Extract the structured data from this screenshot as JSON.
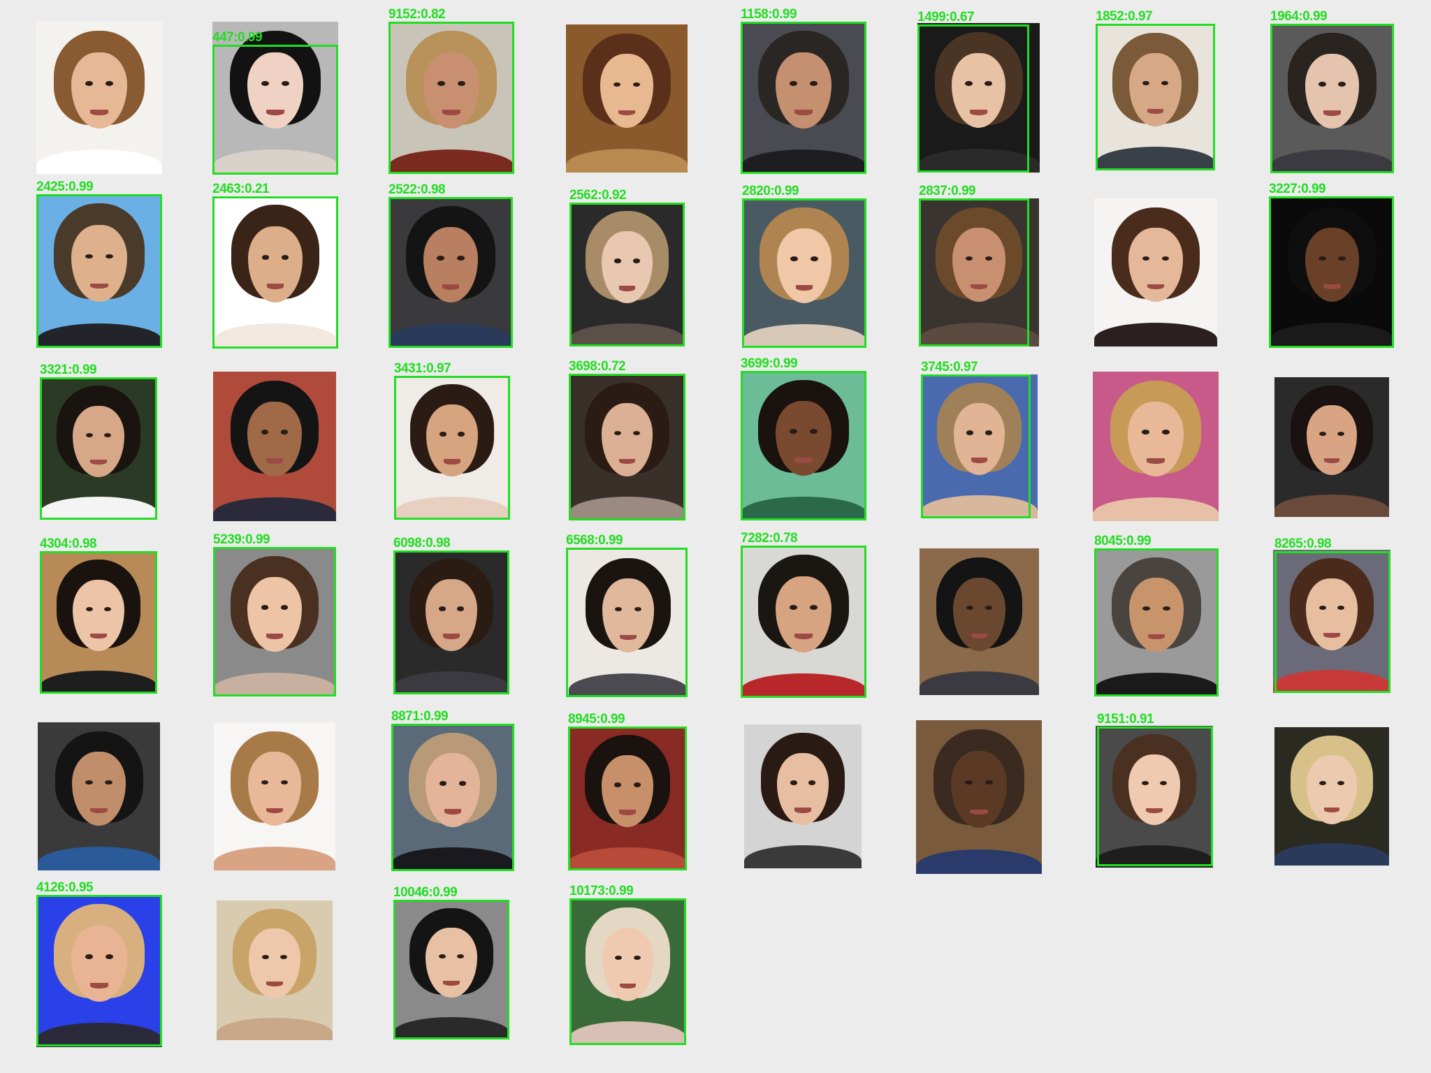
{
  "colors": {
    "background": "#ececec",
    "detection_box": "#22dd22",
    "label": "#22dd22"
  },
  "faces": [
    {
      "label": "",
      "bg": "#f4f2ee",
      "hair": "#8a5a32",
      "skin": "#e6b896",
      "clothes": "#ffffff"
    },
    {
      "label": "447:0.99",
      "bg": "#b8b8b8",
      "hair": "#121212",
      "skin": "#efd2c4",
      "clothes": "#d8d2ca"
    },
    {
      "label": "9152:0.82",
      "bg": "#c9c4b8",
      "hair": "#b8925a",
      "skin": "#c89070",
      "clothes": "#7a2a1e"
    },
    {
      "label": "",
      "bg": "#8a5a2c",
      "hair": "#5a301a",
      "skin": "#e8b890",
      "clothes": "#b88a50"
    },
    {
      "label": "1158:0.99",
      "bg": "#4a4a52",
      "hair": "#2a2624",
      "skin": "#c49070",
      "clothes": "#1e1e22"
    },
    {
      "label": "1499:0.67",
      "bg": "#1a1a1a",
      "hair": "#4a3424",
      "skin": "#e8c2a4",
      "clothes": "#2a2a2a"
    },
    {
      "label": "1852:0.97",
      "bg": "#e8e4dc",
      "hair": "#7a5a38",
      "skin": "#d6a886",
      "clothes": "#3a4048"
    },
    {
      "label": "1964:0.99",
      "bg": "#5a5a5a",
      "hair": "#2a2420",
      "skin": "#e4c4ae",
      "clothes": "#3a3a40"
    },
    {
      "label": "2425:0.99",
      "bg": "#6ab0e4",
      "hair": "#4a3a2a",
      "skin": "#deb08c",
      "clothes": "#22242a"
    },
    {
      "label": "2463:0.21",
      "bg": "#ffffff",
      "hair": "#3a2418",
      "skin": "#dcae8a",
      "clothes": "#f2e8e0"
    },
    {
      "label": "2522:0.98",
      "bg": "#3a3a3c",
      "hair": "#141414",
      "skin": "#b88060",
      "clothes": "#2a3a5a"
    },
    {
      "label": "2562:0.92",
      "bg": "#2a2a2a",
      "hair": "#a88c68",
      "skin": "#e8c8b0",
      "clothes": "#5a5048"
    },
    {
      "label": "2820:0.99",
      "bg": "#4a5a62",
      "hair": "#b08450",
      "skin": "#f0c8a8",
      "clothes": "#d8c8b8"
    },
    {
      "label": "2837:0.99",
      "bg": "#3a3430",
      "hair": "#6a4a2a",
      "skin": "#c89070",
      "clothes": "#5a4a40"
    },
    {
      "label": "",
      "bg": "#f6f4f2",
      "hair": "#4a2c1c",
      "skin": "#e6b89a",
      "clothes": "#2a2020"
    },
    {
      "label": "3227:0.99",
      "bg": "#0a0a0a",
      "hair": "#0e0e0e",
      "skin": "#6a4028",
      "clothes": "#1a1a1a"
    },
    {
      "label": "3321:0.99",
      "bg": "#2a3a24",
      "hair": "#1a1410",
      "skin": "#d6a888",
      "clothes": "#f4f4f4"
    },
    {
      "label": "",
      "bg": "#b04a3a",
      "hair": "#141414",
      "skin": "#a06a48",
      "clothes": "#2a2a3a"
    },
    {
      "label": "3431:0.97",
      "bg": "#efece8",
      "hair": "#2a1c14",
      "skin": "#d6a47e",
      "clothes": "#e8d0c0"
    },
    {
      "label": "3698:0.72",
      "bg": "#3a302a",
      "hair": "#2a1c14",
      "skin": "#dcb094",
      "clothes": "#9a8a80"
    },
    {
      "label": "3699:0.99",
      "bg": "#6cbc98",
      "hair": "#1a120e",
      "skin": "#7a4a30",
      "clothes": "#2a6a4a"
    },
    {
      "label": "3745:0.97",
      "bg": "#4a6ab0",
      "hair": "#a08058",
      "skin": "#e0b494",
      "clothes": "#d8b89c"
    },
    {
      "label": "",
      "bg": "#c85a8a",
      "hair": "#c89a58",
      "skin": "#e8b898",
      "clothes": "#e8c0a8"
    },
    {
      "label": "",
      "bg": "#2a2a2a",
      "hair": "#1a1210",
      "skin": "#d8a484",
      "clothes": "#6a4a3a"
    },
    {
      "label": "4304:0.98",
      "bg": "#b88a58",
      "hair": "#1a120e",
      "skin": "#ecc4a8",
      "clothes": "#1e1e1e"
    },
    {
      "label": "5239:0.99",
      "bg": "#8a8a8a",
      "hair": "#4a3020",
      "skin": "#eec4a6",
      "clothes": "#c8b0a0"
    },
    {
      "label": "6098:0.98",
      "bg": "#2a2a2a",
      "hair": "#2a1c12",
      "skin": "#d6a888",
      "clothes": "#3a3a40"
    },
    {
      "label": "6568:0.99",
      "bg": "#ece8e4",
      "hair": "#1a1410",
      "skin": "#e0b89c",
      "clothes": "#4a4a50"
    },
    {
      "label": "7282:0.78",
      "bg": "#d8d8d4",
      "hair": "#1a1612",
      "skin": "#d6a480",
      "clothes": "#b8282a"
    },
    {
      "label": "",
      "bg": "#8a6a4a",
      "hair": "#141414",
      "skin": "#6a4830",
      "clothes": "#3a3a40"
    },
    {
      "label": "8045:0.99",
      "bg": "#9a9a9a",
      "hair": "#4a4440",
      "skin": "#c8946c",
      "clothes": "#1a1a1a"
    },
    {
      "label": "8265:0.98",
      "bg": "#6a6a78",
      "hair": "#4a2a1a",
      "skin": "#e8bea0",
      "clothes": "#c83a3a"
    },
    {
      "label": "",
      "bg": "#3a3a3a",
      "hair": "#141414",
      "skin": "#c08e6a",
      "clothes": "#2a5a9a"
    },
    {
      "label": "",
      "bg": "#f8f6f4",
      "hair": "#a87a48",
      "skin": "#e8b898",
      "clothes": "#d8a484"
    },
    {
      "label": "8871:0.99",
      "bg": "#5a6a78",
      "hair": "#b89a78",
      "skin": "#e4b49a",
      "clothes": "#1a1a1e"
    },
    {
      "label": "8945:0.99",
      "bg": "#8a2a24",
      "hair": "#1a120e",
      "skin": "#c8906a",
      "clothes": "#b84a3a"
    },
    {
      "label": "",
      "bg": "#d4d4d4",
      "hair": "#2a1a14",
      "skin": "#e8bea2",
      "clothes": "#3a3a3a"
    },
    {
      "label": "",
      "bg": "#7a5a3c",
      "hair": "#3a2a20",
      "skin": "#5a3a24",
      "clothes": "#2a3a6a"
    },
    {
      "label": "9151:0.91",
      "bg": "#4a4a4a",
      "hair": "#4a3020",
      "skin": "#f0cab0",
      "clothes": "#1e1e1e"
    },
    {
      "label": "",
      "bg": "#2a2a20",
      "hair": "#d8c08a",
      "skin": "#eccab0",
      "clothes": "#2a3a5a"
    },
    {
      "label": "4126:0.95",
      "bg": "#2a40e8",
      "hair": "#d8b080",
      "skin": "#e8b494",
      "clothes": "#2a2a3a"
    },
    {
      "label": "",
      "bg": "#d8cbb0",
      "hair": "#c8a468",
      "skin": "#eec8aa",
      "clothes": "#c8a888"
    },
    {
      "label": "10046:0.99",
      "bg": "#8a8a8a",
      "hair": "#141414",
      "skin": "#e8c0a4",
      "clothes": "#2a2a2a"
    },
    {
      "label": "10173:0.99",
      "bg": "#3a6a3a",
      "hair": "#e4d8c4",
      "skin": "#f0cab0",
      "clothes": "#d8c0b4"
    }
  ]
}
